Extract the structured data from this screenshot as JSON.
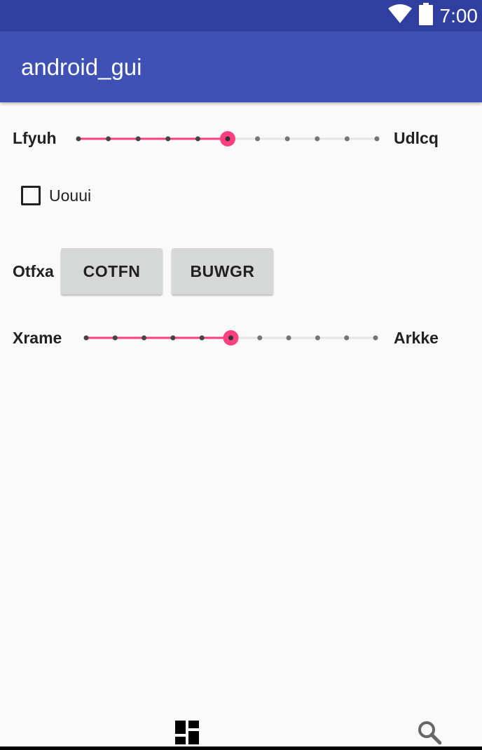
{
  "status_bar": {
    "time": "7:00",
    "icons": [
      "wifi-icon",
      "battery-icon"
    ]
  },
  "app_bar": {
    "title": "android_gui"
  },
  "slider1": {
    "left_label": "Lfyuh",
    "right_label": "Udlcq",
    "steps": 10,
    "value": 5
  },
  "checkbox": {
    "label": "Uouui",
    "checked": false
  },
  "button_row": {
    "label": "Otfxa",
    "button1": "COTFN",
    "button2": "BUWGR"
  },
  "slider2": {
    "left_label": "Xrame",
    "right_label": "Arkke",
    "steps": 10,
    "value": 5
  },
  "bottom_nav": {
    "items": [
      "dashboard-icon",
      "search-icon"
    ]
  },
  "colors": {
    "primary": "#3f51b5",
    "primary_dark": "#303f9f",
    "accent": "#ff4081"
  }
}
